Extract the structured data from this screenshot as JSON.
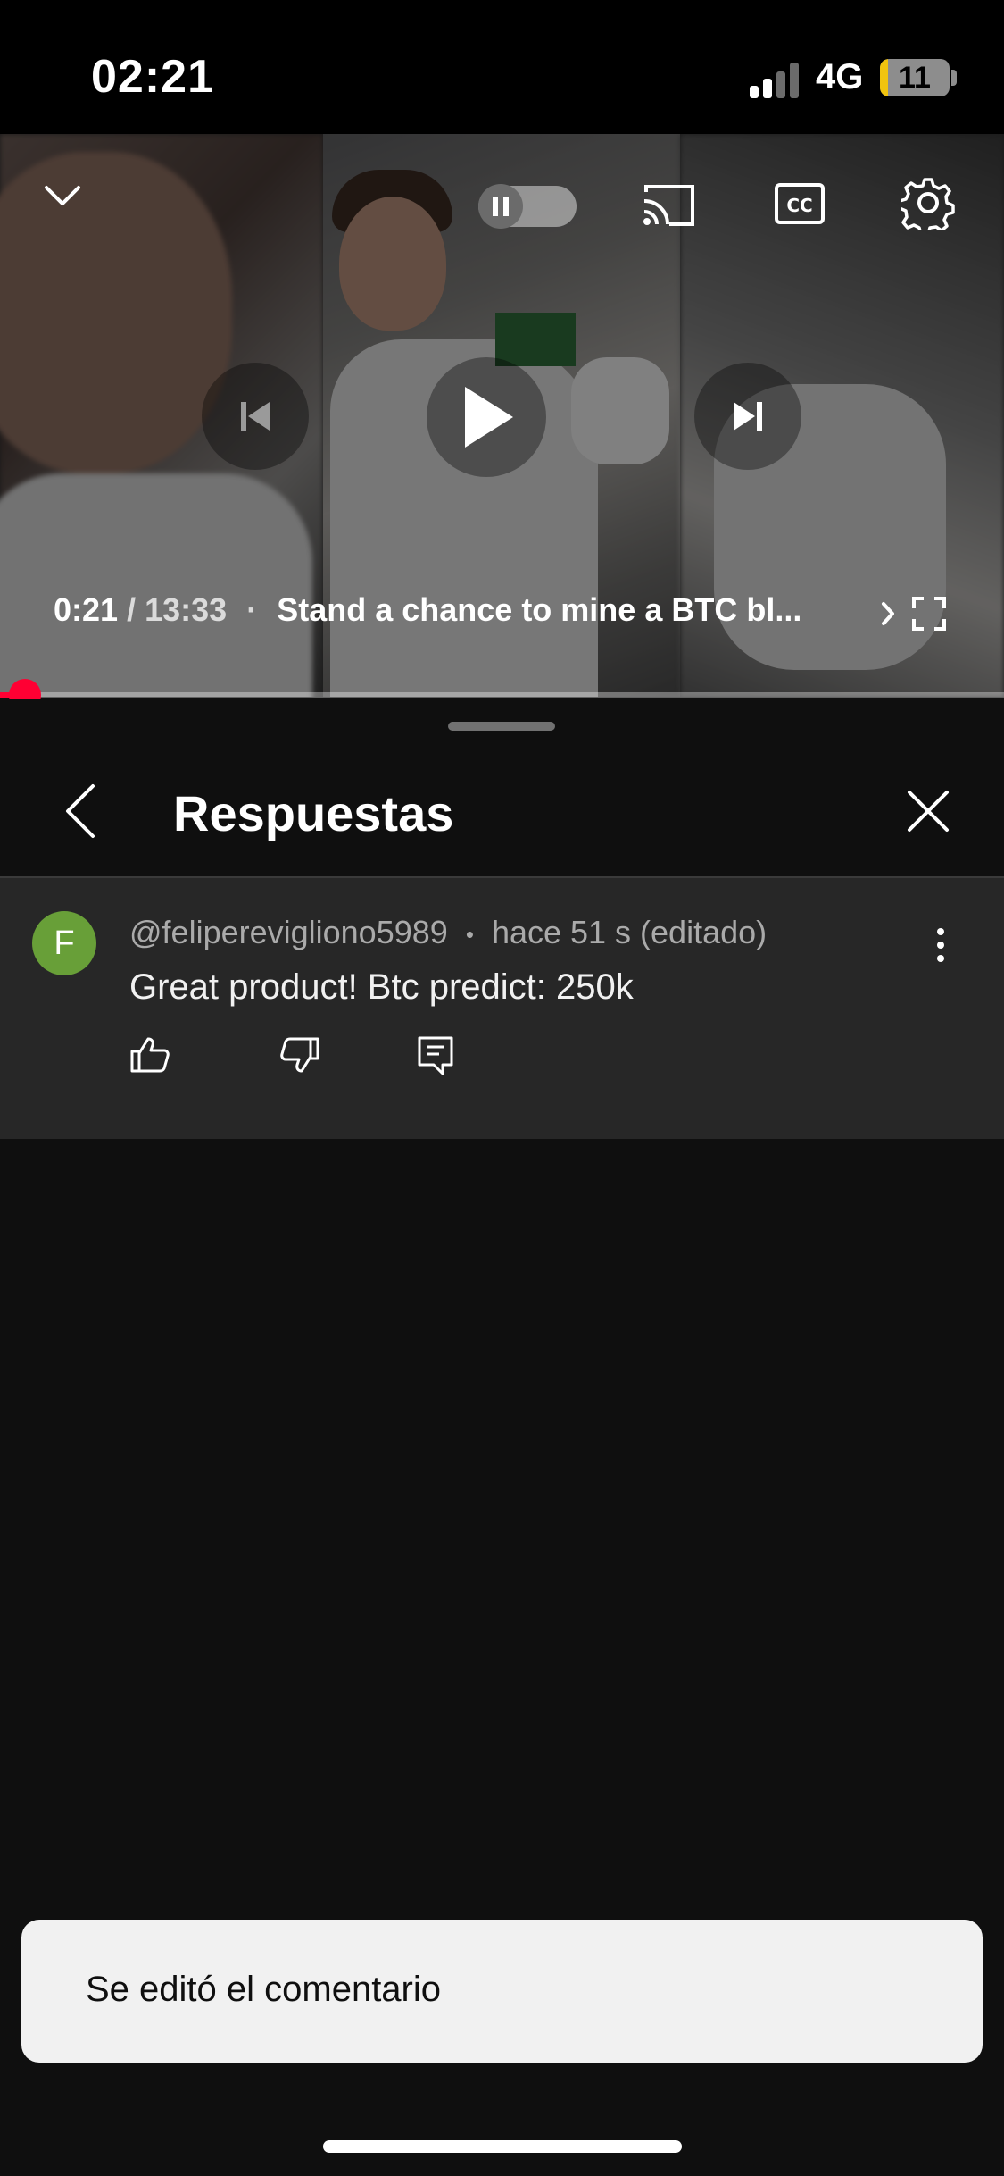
{
  "status_bar": {
    "time": "02:21",
    "network": "4G",
    "battery_level": "11",
    "battery_fraction": 0.11
  },
  "player": {
    "current_time": "0:21",
    "separator": "/",
    "total_time": "13:33",
    "dot": "·",
    "title": "Stand a chance to mine a BTC bl...",
    "progress_fraction": 0.026,
    "accent_color": "#ff0033",
    "icons": {
      "collapse": "chevron-down-icon",
      "autoplay": "pause-icon",
      "cast": "cast-icon",
      "captions": "closed-captions-icon",
      "settings": "gear-icon",
      "previous": "skip-previous-icon",
      "play": "play-icon",
      "next": "skip-next-icon",
      "title_expand": "chevron-right-icon",
      "fullscreen": "fullscreen-icon"
    }
  },
  "replies_panel": {
    "title": "Respuestas",
    "comment": {
      "avatar_letter": "F",
      "avatar_color": "#689f38",
      "author": "@felipereviglionо5989",
      "dot": "•",
      "timestamp": "hace 51 s (editado)",
      "text": "Great product! Btc predict: 250k"
    }
  },
  "snackbar": {
    "message": "Se editó el comentario"
  }
}
